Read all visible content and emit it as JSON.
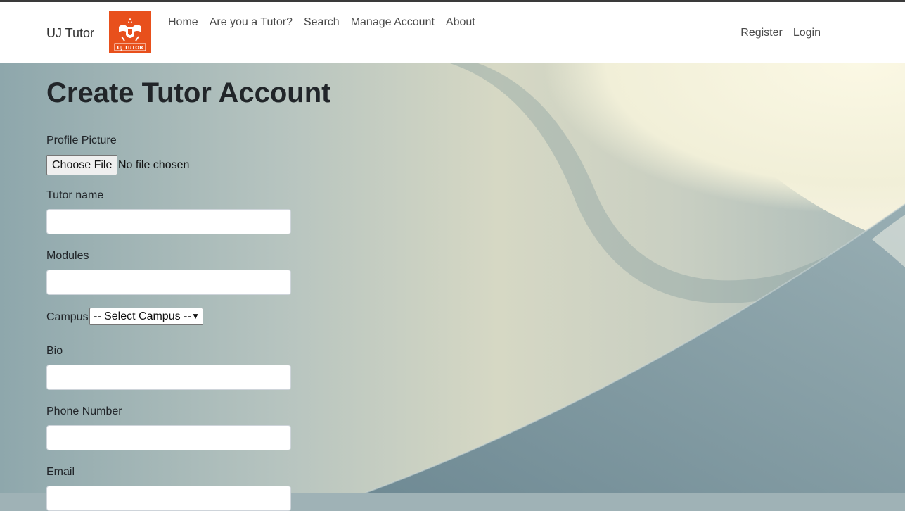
{
  "nav": {
    "brand": "UJ Tutor",
    "logo_text": "UJ TUTOR",
    "links": [
      "Home",
      "Are you a Tutor?",
      "Search",
      "Manage Account",
      "About"
    ],
    "right_links": [
      "Register",
      "Login"
    ]
  },
  "page": {
    "title": "Create Tutor Account"
  },
  "form": {
    "profile_picture_label": "Profile Picture",
    "choose_file_label": "Choose File",
    "no_file_text": "No file chosen",
    "tutor_name_label": "Tutor name",
    "tutor_name_value": "",
    "modules_label": "Modules",
    "modules_value": "",
    "campus_label": "Campus",
    "campus_selected": "-- Select Campus --",
    "bio_label": "Bio",
    "bio_value": "",
    "phone_label": "Phone Number",
    "phone_value": "",
    "email_label": "Email",
    "email_value": ""
  },
  "colors": {
    "logo_orange": "#e8501c",
    "navbar_bg": "#ffffff"
  }
}
